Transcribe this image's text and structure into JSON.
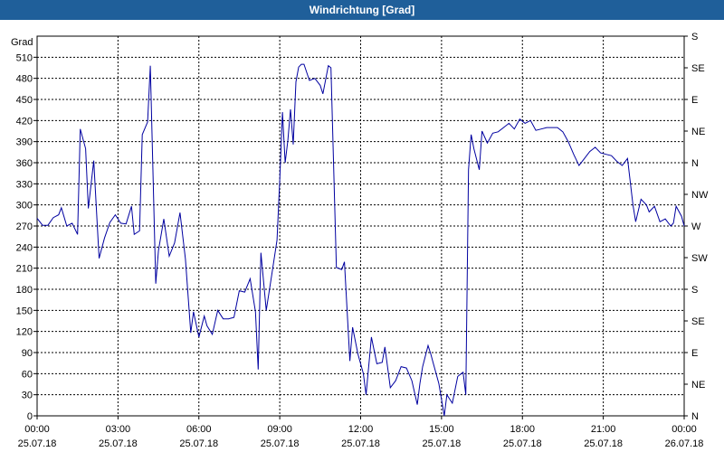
{
  "window": {
    "title": "Windrichtung [Grad]"
  },
  "chart_data": {
    "type": "line",
    "title": "Windrichtung [Grad]",
    "ylabel": "Grad",
    "xlabel": "",
    "ylim": [
      0,
      540
    ],
    "y_ticks": [
      0,
      30,
      60,
      90,
      120,
      150,
      180,
      210,
      240,
      270,
      300,
      330,
      360,
      390,
      420,
      450,
      480,
      510
    ],
    "y2_ticks": [
      {
        "value": 0,
        "label": "N"
      },
      {
        "value": 45,
        "label": "NE"
      },
      {
        "value": 90,
        "label": "E"
      },
      {
        "value": 135,
        "label": "SE"
      },
      {
        "value": 180,
        "label": "S"
      },
      {
        "value": 225,
        "label": "SW"
      },
      {
        "value": 270,
        "label": "W"
      },
      {
        "value": 315,
        "label": "NW"
      },
      {
        "value": 360,
        "label": "N"
      },
      {
        "value": 405,
        "label": "NE"
      },
      {
        "value": 450,
        "label": "E"
      },
      {
        "value": 495,
        "label": "SE"
      },
      {
        "value": 540,
        "label": "S"
      }
    ],
    "x_ticks": [
      {
        "time": "00:00",
        "date": "25.07.18"
      },
      {
        "time": "03:00",
        "date": "25.07.18"
      },
      {
        "time": "06:00",
        "date": "25.07.18"
      },
      {
        "time": "09:00",
        "date": "25.07.18"
      },
      {
        "time": "12:00",
        "date": "25.07.18"
      },
      {
        "time": "15:00",
        "date": "25.07.18"
      },
      {
        "time": "18:00",
        "date": "25.07.18"
      },
      {
        "time": "21:00",
        "date": "25.07.18"
      },
      {
        "time": "00:00",
        "date": "26.07.18"
      }
    ],
    "grid": true,
    "series": [
      {
        "color": "#0000a0",
        "points": [
          [
            "00:00",
            281
          ],
          [
            "00:12",
            271
          ],
          [
            "00:24",
            271
          ],
          [
            "00:36",
            282
          ],
          [
            "00:48",
            286
          ],
          [
            "00:54",
            296
          ],
          [
            "01:06",
            270
          ],
          [
            "01:18",
            274
          ],
          [
            "01:30",
            258
          ],
          [
            "01:36",
            408
          ],
          [
            "01:48",
            380
          ],
          [
            "01:54",
            295
          ],
          [
            "02:06",
            363
          ],
          [
            "02:18",
            224
          ],
          [
            "02:30",
            253
          ],
          [
            "02:42",
            275
          ],
          [
            "02:54",
            286
          ],
          [
            "03:06",
            274
          ],
          [
            "03:18",
            273
          ],
          [
            "03:30",
            298
          ],
          [
            "03:36",
            258
          ],
          [
            "03:48",
            263
          ],
          [
            "03:54",
            400
          ],
          [
            "04:06",
            418
          ],
          [
            "04:12",
            498
          ],
          [
            "04:24",
            188
          ],
          [
            "04:30",
            235
          ],
          [
            "04:42",
            280
          ],
          [
            "04:54",
            227
          ],
          [
            "05:06",
            246
          ],
          [
            "05:18",
            289
          ],
          [
            "05:30",
            223
          ],
          [
            "05:42",
            118
          ],
          [
            "05:48",
            148
          ],
          [
            "06:00",
            112
          ],
          [
            "06:12",
            142
          ],
          [
            "06:18",
            128
          ],
          [
            "06:30",
            116
          ],
          [
            "06:42",
            150
          ],
          [
            "06:54",
            138
          ],
          [
            "07:06",
            138
          ],
          [
            "07:18",
            140
          ],
          [
            "07:30",
            178
          ],
          [
            "07:42",
            176
          ],
          [
            "07:54",
            195
          ],
          [
            "08:06",
            148
          ],
          [
            "08:12",
            66
          ],
          [
            "08:18",
            232
          ],
          [
            "08:30",
            150
          ],
          [
            "08:42",
            200
          ],
          [
            "08:54",
            250
          ],
          [
            "09:00",
            335
          ],
          [
            "09:06",
            432
          ],
          [
            "09:12",
            360
          ],
          [
            "09:18",
            392
          ],
          [
            "09:24",
            436
          ],
          [
            "09:30",
            386
          ],
          [
            "09:36",
            475
          ],
          [
            "09:42",
            496
          ],
          [
            "09:48",
            500
          ],
          [
            "09:54",
            500
          ],
          [
            "10:06",
            477
          ],
          [
            "10:18",
            480
          ],
          [
            "10:30",
            470
          ],
          [
            "10:36",
            458
          ],
          [
            "10:48",
            498
          ],
          [
            "10:54",
            495
          ],
          [
            "11:06",
            211
          ],
          [
            "11:18",
            208
          ],
          [
            "11:24",
            219
          ],
          [
            "11:36",
            78
          ],
          [
            "11:42",
            126
          ],
          [
            "11:54",
            88
          ],
          [
            "12:06",
            60
          ],
          [
            "12:12",
            30
          ],
          [
            "12:24",
            112
          ],
          [
            "12:36",
            74
          ],
          [
            "12:48",
            76
          ],
          [
            "12:54",
            98
          ],
          [
            "13:06",
            40
          ],
          [
            "13:18",
            50
          ],
          [
            "13:30",
            70
          ],
          [
            "13:42",
            68
          ],
          [
            "13:54",
            50
          ],
          [
            "14:06",
            16
          ],
          [
            "14:12",
            46
          ],
          [
            "14:18",
            70
          ],
          [
            "14:30",
            100
          ],
          [
            "14:36",
            88
          ],
          [
            "14:42",
            74
          ],
          [
            "14:54",
            46
          ],
          [
            "15:06",
            0
          ],
          [
            "15:12",
            30
          ],
          [
            "15:24",
            18
          ],
          [
            "15:36",
            56
          ],
          [
            "15:48",
            62
          ],
          [
            "15:54",
            30
          ],
          [
            "16:00",
            350
          ],
          [
            "16:06",
            400
          ],
          [
            "16:12",
            380
          ],
          [
            "16:24",
            350
          ],
          [
            "16:30",
            405
          ],
          [
            "16:42",
            388
          ],
          [
            "16:54",
            402
          ],
          [
            "17:06",
            404
          ],
          [
            "17:18",
            410
          ],
          [
            "17:30",
            416
          ],
          [
            "17:42",
            408
          ],
          [
            "17:54",
            422
          ],
          [
            "18:06",
            416
          ],
          [
            "18:18",
            420
          ],
          [
            "18:30",
            406
          ],
          [
            "18:42",
            408
          ],
          [
            "18:54",
            410
          ],
          [
            "19:06",
            410
          ],
          [
            "19:18",
            410
          ],
          [
            "19:30",
            404
          ],
          [
            "19:42",
            390
          ],
          [
            "19:54",
            372
          ],
          [
            "20:06",
            356
          ],
          [
            "20:18",
            366
          ],
          [
            "20:30",
            376
          ],
          [
            "20:42",
            382
          ],
          [
            "20:54",
            374
          ],
          [
            "21:06",
            372
          ],
          [
            "21:18",
            370
          ],
          [
            "21:30",
            362
          ],
          [
            "21:42",
            356
          ],
          [
            "21:54",
            366
          ],
          [
            "22:06",
            300
          ],
          [
            "22:12",
            276
          ],
          [
            "22:24",
            308
          ],
          [
            "22:36",
            300
          ],
          [
            "22:42",
            290
          ],
          [
            "22:54",
            298
          ],
          [
            "23:06",
            276
          ],
          [
            "23:18",
            280
          ],
          [
            "23:30",
            270
          ],
          [
            "23:36",
            274
          ],
          [
            "23:42",
            298
          ],
          [
            "23:54",
            284
          ],
          [
            "24:00",
            270
          ]
        ]
      }
    ]
  }
}
